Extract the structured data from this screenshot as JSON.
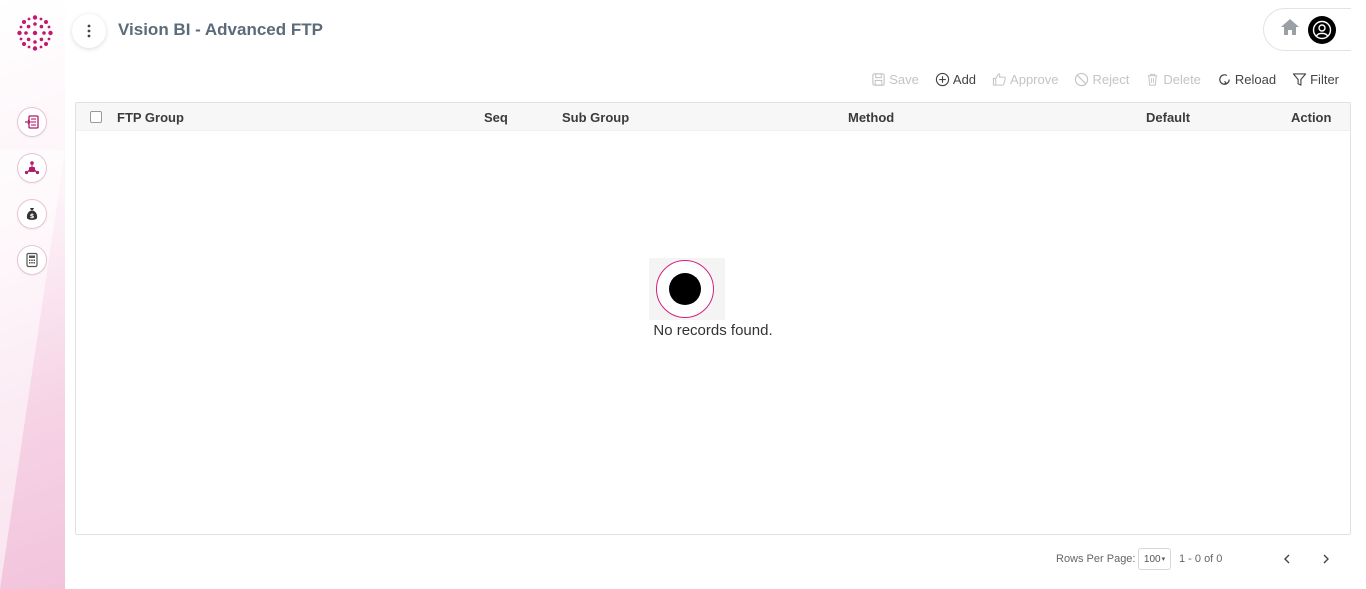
{
  "app": {
    "title": "Vision BI - Advanced FTP"
  },
  "brand": {
    "accent": "#d4217c"
  },
  "sidebar": {
    "items": [
      {
        "icon": "document-arrow-icon"
      },
      {
        "icon": "org-network-icon"
      },
      {
        "icon": "money-bag-icon"
      },
      {
        "icon": "calculator-icon"
      }
    ]
  },
  "header": {
    "home_icon": "home-icon",
    "avatar_icon": "user-avatar-icon"
  },
  "toolbar": {
    "save": "Save",
    "add": "Add",
    "approve": "Approve",
    "reject": "Reject",
    "delete": "Delete",
    "reload": "Reload",
    "filter": "Filter"
  },
  "table": {
    "columns": [
      "FTP Group",
      "Seq",
      "Sub Group",
      "Method",
      "Default",
      "Action"
    ],
    "rows": [],
    "empty_message": "No records found."
  },
  "pagination": {
    "rows_per_page_label": "Rows Per Page:",
    "rows_per_page": "100",
    "range": "1 - 0 of 0"
  }
}
